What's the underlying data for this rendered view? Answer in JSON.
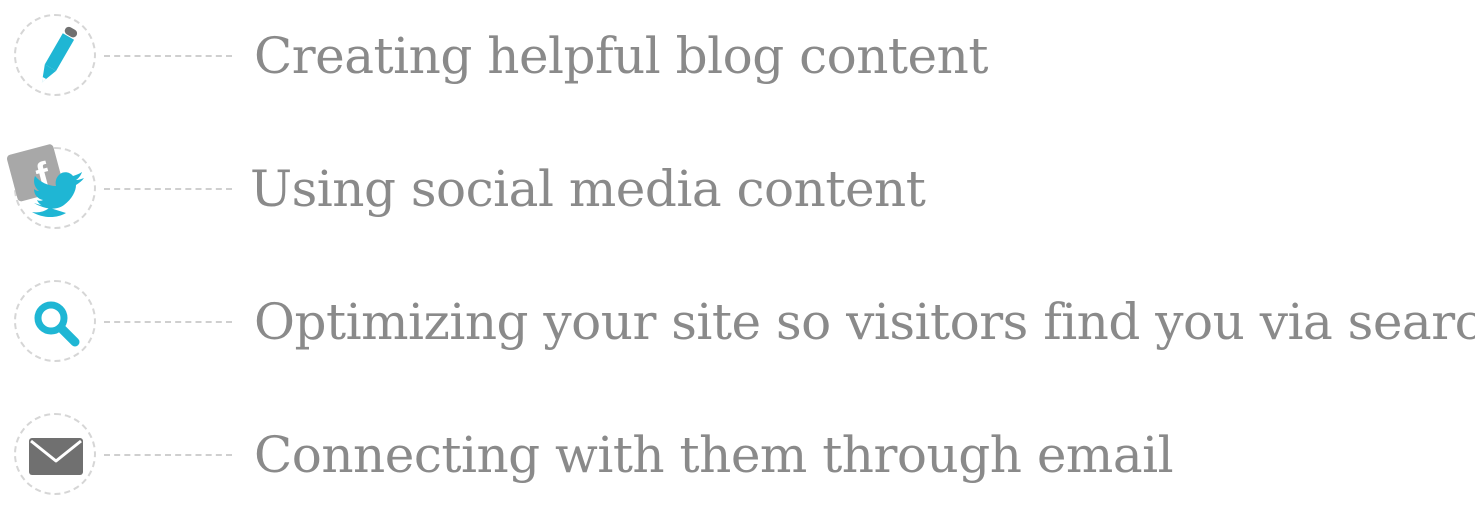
{
  "items": [
    {
      "icon": "pencil-icon",
      "label": "Creating helpful blog content"
    },
    {
      "icon": "facebook-twitter-icon",
      "label": "Using social media content"
    },
    {
      "icon": "search-icon",
      "label": "Optimizing your site so visitors find you via search"
    },
    {
      "icon": "envelope-icon",
      "label": "Connecting with them through email"
    }
  ],
  "colors": {
    "accent": "#1fb6d4",
    "text": "#8a8a8a",
    "icon_gray": "#707070",
    "facebook_gray": "#a8a8a8",
    "dashes": "#d6d6d6"
  }
}
